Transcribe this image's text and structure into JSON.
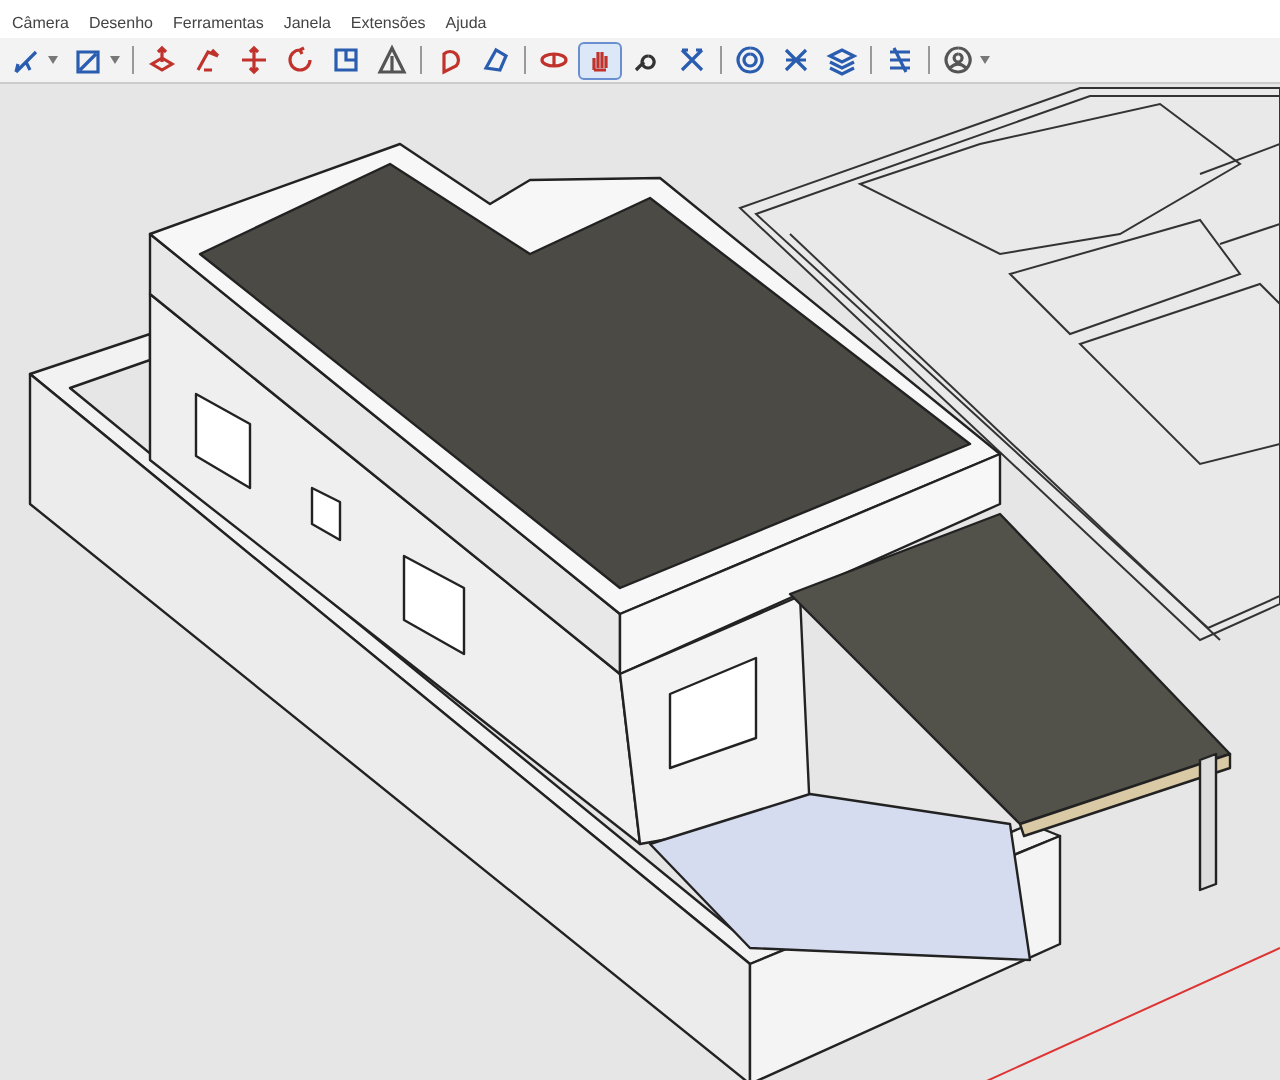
{
  "menu": [
    {
      "label": "Câmera"
    },
    {
      "label": "Desenho"
    },
    {
      "label": "Ferramentas"
    },
    {
      "label": "Janela"
    },
    {
      "label": "Extensões"
    },
    {
      "label": "Ajuda"
    }
  ],
  "toolbar": [
    [
      {
        "kind": "line",
        "selected": false,
        "dropdown": true
      },
      {
        "kind": "rect",
        "selected": false,
        "dropdown": true
      }
    ],
    [
      {
        "kind": "pushpull",
        "selected": false,
        "dropdown": false
      },
      {
        "kind": "followme",
        "selected": false,
        "dropdown": false
      },
      {
        "kind": "move",
        "selected": false,
        "dropdown": false
      },
      {
        "kind": "rotate",
        "selected": false,
        "dropdown": false
      },
      {
        "kind": "scale",
        "selected": false,
        "dropdown": false
      },
      {
        "kind": "measure",
        "selected": false,
        "dropdown": false
      }
    ],
    [
      {
        "kind": "paint",
        "selected": false,
        "dropdown": false
      },
      {
        "kind": "section",
        "selected": false,
        "dropdown": false
      }
    ],
    [
      {
        "kind": "orbit",
        "selected": false,
        "dropdown": false
      },
      {
        "kind": "hand",
        "selected": true,
        "dropdown": false
      },
      {
        "kind": "zoom",
        "selected": false,
        "dropdown": false
      },
      {
        "kind": "extents",
        "selected": false,
        "dropdown": false
      }
    ],
    [
      {
        "kind": "warehouse",
        "selected": false,
        "dropdown": false
      },
      {
        "kind": "extension",
        "selected": false,
        "dropdown": false
      },
      {
        "kind": "layers",
        "selected": false,
        "dropdown": false
      }
    ],
    [
      {
        "kind": "styles",
        "selected": false,
        "dropdown": false
      }
    ],
    [
      {
        "kind": "account",
        "selected": false,
        "dropdown": true
      }
    ]
  ]
}
